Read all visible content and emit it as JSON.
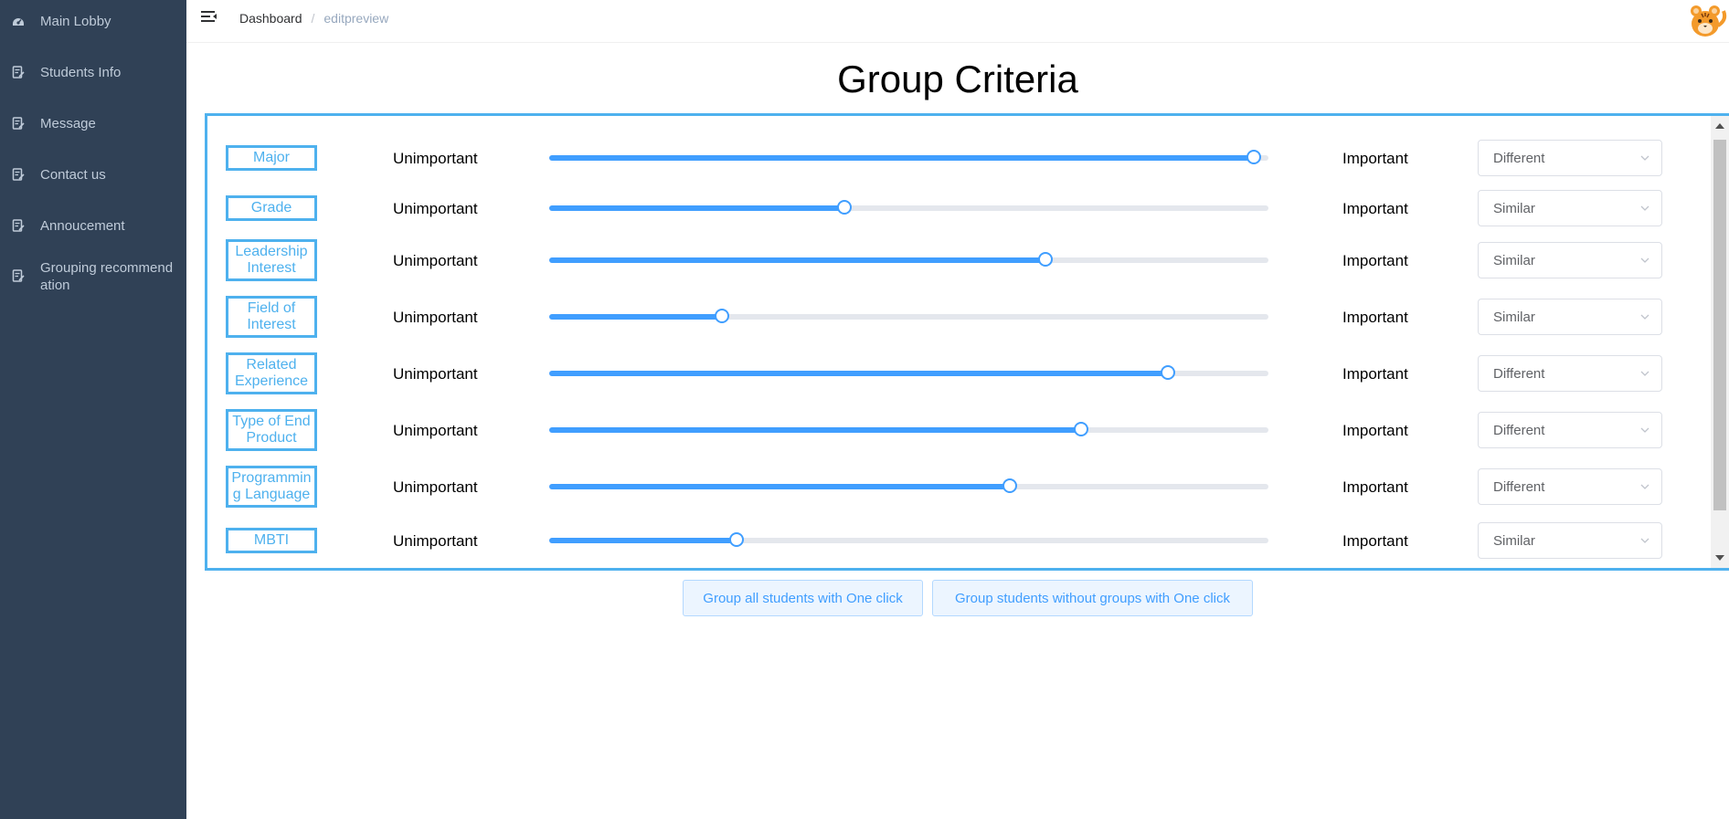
{
  "sidebar": {
    "items": [
      {
        "label": "Main Lobby",
        "icon": "dashboard-icon"
      },
      {
        "label": "Students Info",
        "icon": "document-edit-icon"
      },
      {
        "label": "Message",
        "icon": "document-edit-icon"
      },
      {
        "label": "Contact us",
        "icon": "document-edit-icon"
      },
      {
        "label": "Annoucement",
        "icon": "document-edit-icon"
      },
      {
        "label": "Grouping recommendation",
        "icon": "document-edit-icon"
      }
    ]
  },
  "header": {
    "breadcrumb_home": "Dashboard",
    "breadcrumb_sep": "/",
    "breadcrumb_current": "editpreview"
  },
  "page": {
    "title": "Group Criteria"
  },
  "criteria": {
    "left_label": "Unimportant",
    "right_label": "Important",
    "rows": [
      {
        "label": "Major",
        "value": 0.98,
        "mode": "Different"
      },
      {
        "label": "Grade",
        "value": 0.41,
        "mode": "Similar"
      },
      {
        "label": "Leadership Interest",
        "value": 0.69,
        "mode": "Similar"
      },
      {
        "label": "Field of Interest",
        "value": 0.24,
        "mode": "Similar"
      },
      {
        "label": "Related Experience",
        "value": 0.86,
        "mode": "Different"
      },
      {
        "label": "Type of End Product",
        "value": 0.74,
        "mode": "Different"
      },
      {
        "label": "Programming Language",
        "value": 0.64,
        "mode": "Different"
      },
      {
        "label": "MBTI",
        "value": 0.26,
        "mode": "Similar"
      }
    ]
  },
  "actions": {
    "group_all": "Group all students with One click",
    "group_without": "Group students without groups with One click"
  },
  "colors": {
    "sidebar_bg": "#304156",
    "accent": "#409eff",
    "frame": "#4eb1ee"
  }
}
